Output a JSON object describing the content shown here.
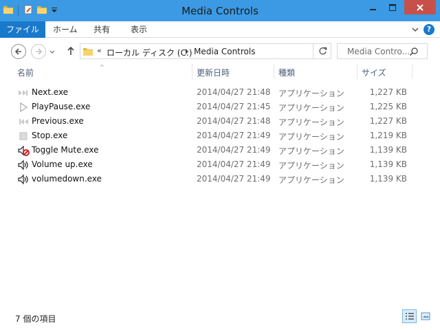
{
  "window": {
    "title": "Media Controls"
  },
  "ribbon": {
    "tabs": [
      "ファイル",
      "ホーム",
      "共有",
      "表示"
    ]
  },
  "address": {
    "overflow": "«",
    "crumbs": [
      "ローカル ディスク (C:)",
      "Media Controls"
    ]
  },
  "search": {
    "placeholder": "Media Contro..."
  },
  "columns": {
    "name": "名前",
    "date": "更新日時",
    "type": "種類",
    "size": "サイズ"
  },
  "files": [
    {
      "name": "Next.exe",
      "date": "2014/04/27 21:48",
      "type": "アプリケーション",
      "size": "1,227 KB",
      "icon": "next-track-icon"
    },
    {
      "name": "PlayPause.exe",
      "date": "2014/04/27 21:45",
      "type": "アプリケーション",
      "size": "1,225 KB",
      "icon": "play-icon"
    },
    {
      "name": "Previous.exe",
      "date": "2014/04/27 21:48",
      "type": "アプリケーション",
      "size": "1,227 KB",
      "icon": "previous-track-icon"
    },
    {
      "name": "Stop.exe",
      "date": "2014/04/27 21:49",
      "type": "アプリケーション",
      "size": "1,219 KB",
      "icon": "stop-icon"
    },
    {
      "name": "Toggle Mute.exe",
      "date": "2014/04/27 21:49",
      "type": "アプリケーション",
      "size": "1,139 KB",
      "icon": "mute-speaker-icon"
    },
    {
      "name": "Volume up.exe",
      "date": "2014/04/27 21:49",
      "type": "アプリケーション",
      "size": "1,139 KB",
      "icon": "speaker-icon"
    },
    {
      "name": "volumedown.exe",
      "date": "2014/04/27 21:49",
      "type": "アプリケーション",
      "size": "1,139 KB",
      "icon": "speaker-icon"
    }
  ],
  "status": {
    "item_count": "7 個の項目"
  },
  "colors": {
    "titlebar": "#3c9ae4",
    "file_tab": "#1979ca",
    "close_button": "#c7504a",
    "header_text": "#4c607a"
  }
}
